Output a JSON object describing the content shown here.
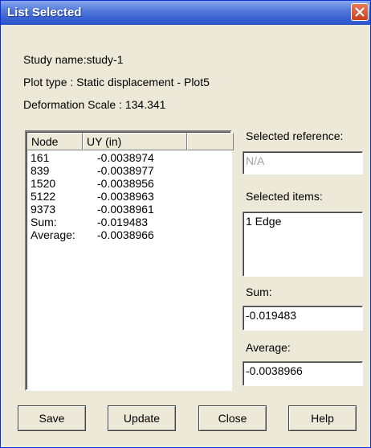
{
  "window": {
    "title": "List Selected"
  },
  "info": {
    "study_name": "Study name:study-1",
    "plot_type": "Plot type : Static displacement - Plot5",
    "deformation_scale": "Deformation Scale : 134.341"
  },
  "list": {
    "columns": [
      "Node",
      "UY (in)",
      ""
    ],
    "rows": [
      {
        "node": "161",
        "uy": "-0.0038974"
      },
      {
        "node": "839",
        "uy": "-0.0038977"
      },
      {
        "node": "1520",
        "uy": "-0.0038956"
      },
      {
        "node": "5122",
        "uy": "-0.0038963"
      },
      {
        "node": "9373",
        "uy": "-0.0038961"
      },
      {
        "node": "Sum:",
        "uy": "-0.019483"
      },
      {
        "node": "Average:",
        "uy": "-0.0038966"
      }
    ]
  },
  "right_panel": {
    "selected_reference_label": "Selected reference:",
    "selected_reference_value": "N/A",
    "selected_items_label": "Selected items:",
    "selected_items_value": "1 Edge",
    "sum_label": "Sum:",
    "sum_value": "-0.019483",
    "average_label": "Average:",
    "average_value": "-0.0038966"
  },
  "buttons": {
    "save": "Save",
    "update": "Update",
    "close": "Close",
    "help": "Help"
  }
}
